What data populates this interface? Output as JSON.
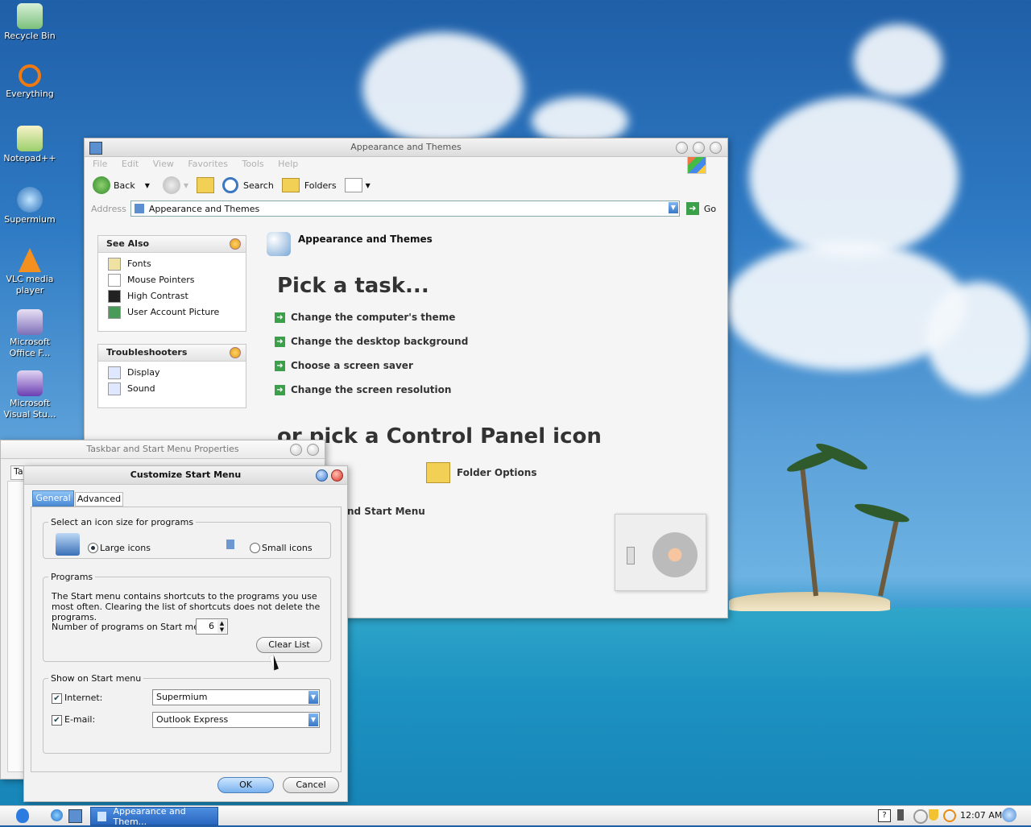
{
  "desktop": {
    "icons": [
      {
        "label": "Recycle Bin",
        "icon": "recycle-bin-icon"
      },
      {
        "label": "Everything",
        "icon": "everything-icon"
      },
      {
        "label": "Notepad++",
        "icon": "notepad-icon"
      },
      {
        "label": "Supermium",
        "icon": "supermium-icon"
      },
      {
        "label": "VLC media player",
        "icon": "vlc-icon"
      },
      {
        "label": "Microsoft Office F...",
        "icon": "office-icon"
      },
      {
        "label": "Microsoft Visual Stu...",
        "icon": "visual-studio-icon"
      }
    ]
  },
  "explorer": {
    "title": "Appearance and Themes",
    "menu": [
      "File",
      "Edit",
      "View",
      "Favorites",
      "Tools",
      "Help"
    ],
    "toolbar": {
      "back": "Back",
      "search": "Search",
      "folders": "Folders"
    },
    "address": {
      "label": "Address",
      "value": "Appearance and Themes",
      "go": "Go"
    },
    "see_also": {
      "title": "See Also",
      "items": [
        "Fonts",
        "Mouse Pointers",
        "High Contrast",
        "User Account Picture"
      ]
    },
    "troubleshooters": {
      "title": "Troubleshooters",
      "items": [
        "Display",
        "Sound"
      ]
    },
    "header": "Appearance and Themes",
    "pick_task": "Pick a task...",
    "tasks": [
      "Change the computer's theme",
      "Change the desktop background",
      "Choose a screen saver",
      "Change the screen resolution"
    ],
    "or_pick": "or pick a Control Panel icon",
    "icons": [
      "Folder Options",
      "nd Start Menu"
    ]
  },
  "taskbar_props": {
    "title": "Taskbar and Start Menu Properties",
    "tab_fragment": "Ta"
  },
  "customize": {
    "title": "Customize Start Menu",
    "tabs": [
      "General",
      "Advanced"
    ],
    "icon_size": {
      "legend": "Select an icon size for programs",
      "large": "Large icons",
      "small": "Small icons",
      "selected": "large"
    },
    "programs": {
      "legend": "Programs",
      "desc": "The Start menu contains shortcuts to the programs you use most often. Clearing the list of shortcuts does not delete the programs.",
      "count_label": "Number of programs on Start menu:",
      "count": "6",
      "clear": "Clear List"
    },
    "show": {
      "legend": "Show on Start menu",
      "internet_label": "Internet:",
      "internet_value": "Supermium",
      "email_label": "E-mail:",
      "email_value": "Outlook Express"
    },
    "ok": "OK",
    "cancel": "Cancel"
  },
  "taskbar": {
    "active_task": "Appearance and Them...",
    "clock": "12:07 AM"
  }
}
